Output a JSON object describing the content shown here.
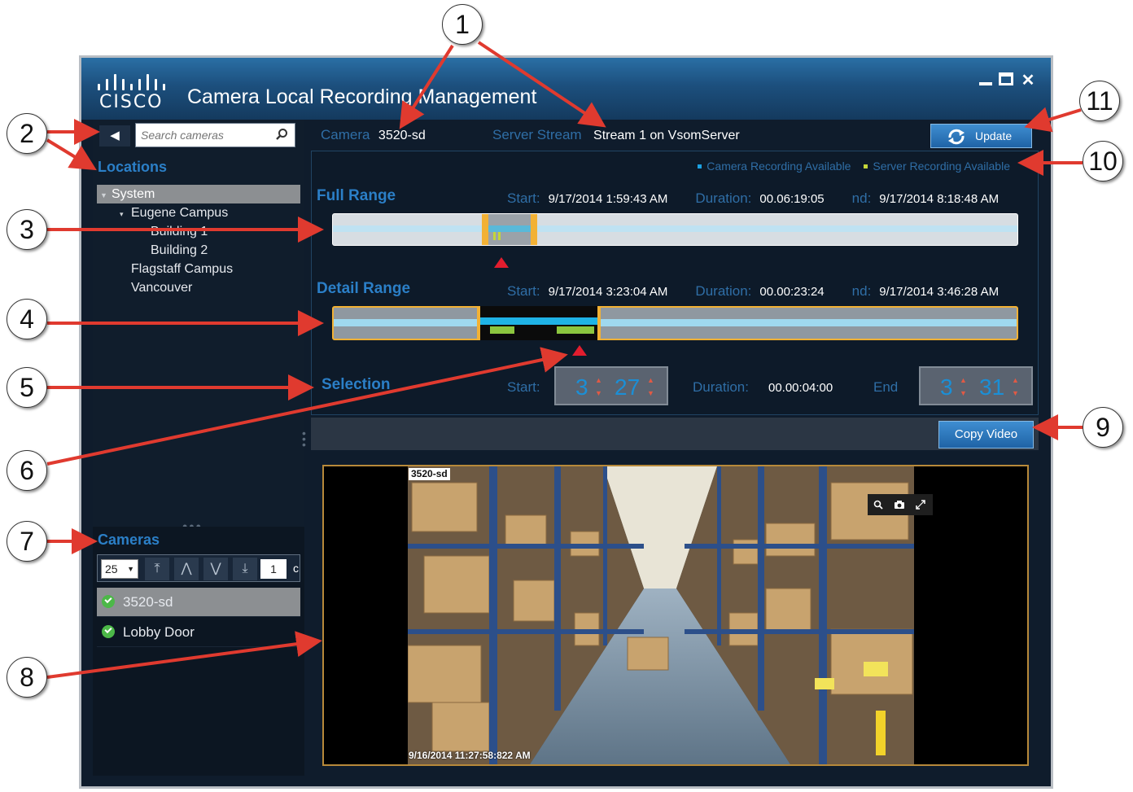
{
  "window": {
    "brand": "CISCO",
    "title": "Camera Local Recording Management",
    "controls": [
      "minimize",
      "maximize",
      "close"
    ]
  },
  "sidebar": {
    "search_placeholder": "Search cameras",
    "locations_header": "Locations",
    "tree": [
      {
        "label": "System",
        "level": 0,
        "selected": true
      },
      {
        "label": "Eugene Campus",
        "level": 1
      },
      {
        "label": "Building 1",
        "level": 2
      },
      {
        "label": "Building 2",
        "level": 2
      },
      {
        "label": "Flagstaff Campus",
        "level": 1
      },
      {
        "label": "Vancouver",
        "level": 1
      }
    ],
    "cameras_header": "Cameras",
    "page_size": "25",
    "page_number": "1",
    "page_extra": "c",
    "cameras": [
      {
        "name": "3520-sd",
        "status": "ok",
        "selected": true
      },
      {
        "name": "Lobby Door",
        "status": "ok",
        "selected": false
      }
    ]
  },
  "header": {
    "camera_label": "Camera",
    "camera_value": "3520-sd",
    "stream_label": "Server Stream",
    "stream_value": "Stream 1 on VsomServer",
    "update_label": "Update"
  },
  "legend": {
    "camera_recording": "Camera Recording Available",
    "server_recording": "Server Recording Available",
    "camera_color": "#1ba1e2",
    "server_color": "#c4d63a"
  },
  "full_range": {
    "title": "Full Range",
    "start_label": "Start:",
    "start": "9/17/2014 1:59:43 AM",
    "duration_label": "Duration:",
    "duration": "00.06:19:05",
    "end_label": "nd:",
    "end": "9/17/2014 8:18:48 AM"
  },
  "detail_range": {
    "title": "Detail Range",
    "start_label": "Start:",
    "start": "9/17/2014 3:23:04 AM",
    "duration_label": "Duration:",
    "duration": "00.00:23:24",
    "end_label": "nd:",
    "end": "9/17/2014 3:46:28 AM"
  },
  "selection": {
    "title": "Selection",
    "start_label": "Start:",
    "start_hour": "3",
    "start_min": "27",
    "duration_label": "Duration:",
    "duration": "00.00:04:00",
    "end_label": "End",
    "end_hour": "3",
    "end_min": "31"
  },
  "copy_video_label": "Copy Video",
  "video": {
    "camera_label": "3520-sd",
    "timestamp": "9/16/2014 11:27:58:822 AM",
    "tools": [
      "zoom-icon",
      "snapshot-icon",
      "expand-icon"
    ]
  },
  "callouts": [
    "1",
    "2",
    "3",
    "4",
    "5",
    "6",
    "7",
    "8",
    "9",
    "10",
    "11"
  ]
}
